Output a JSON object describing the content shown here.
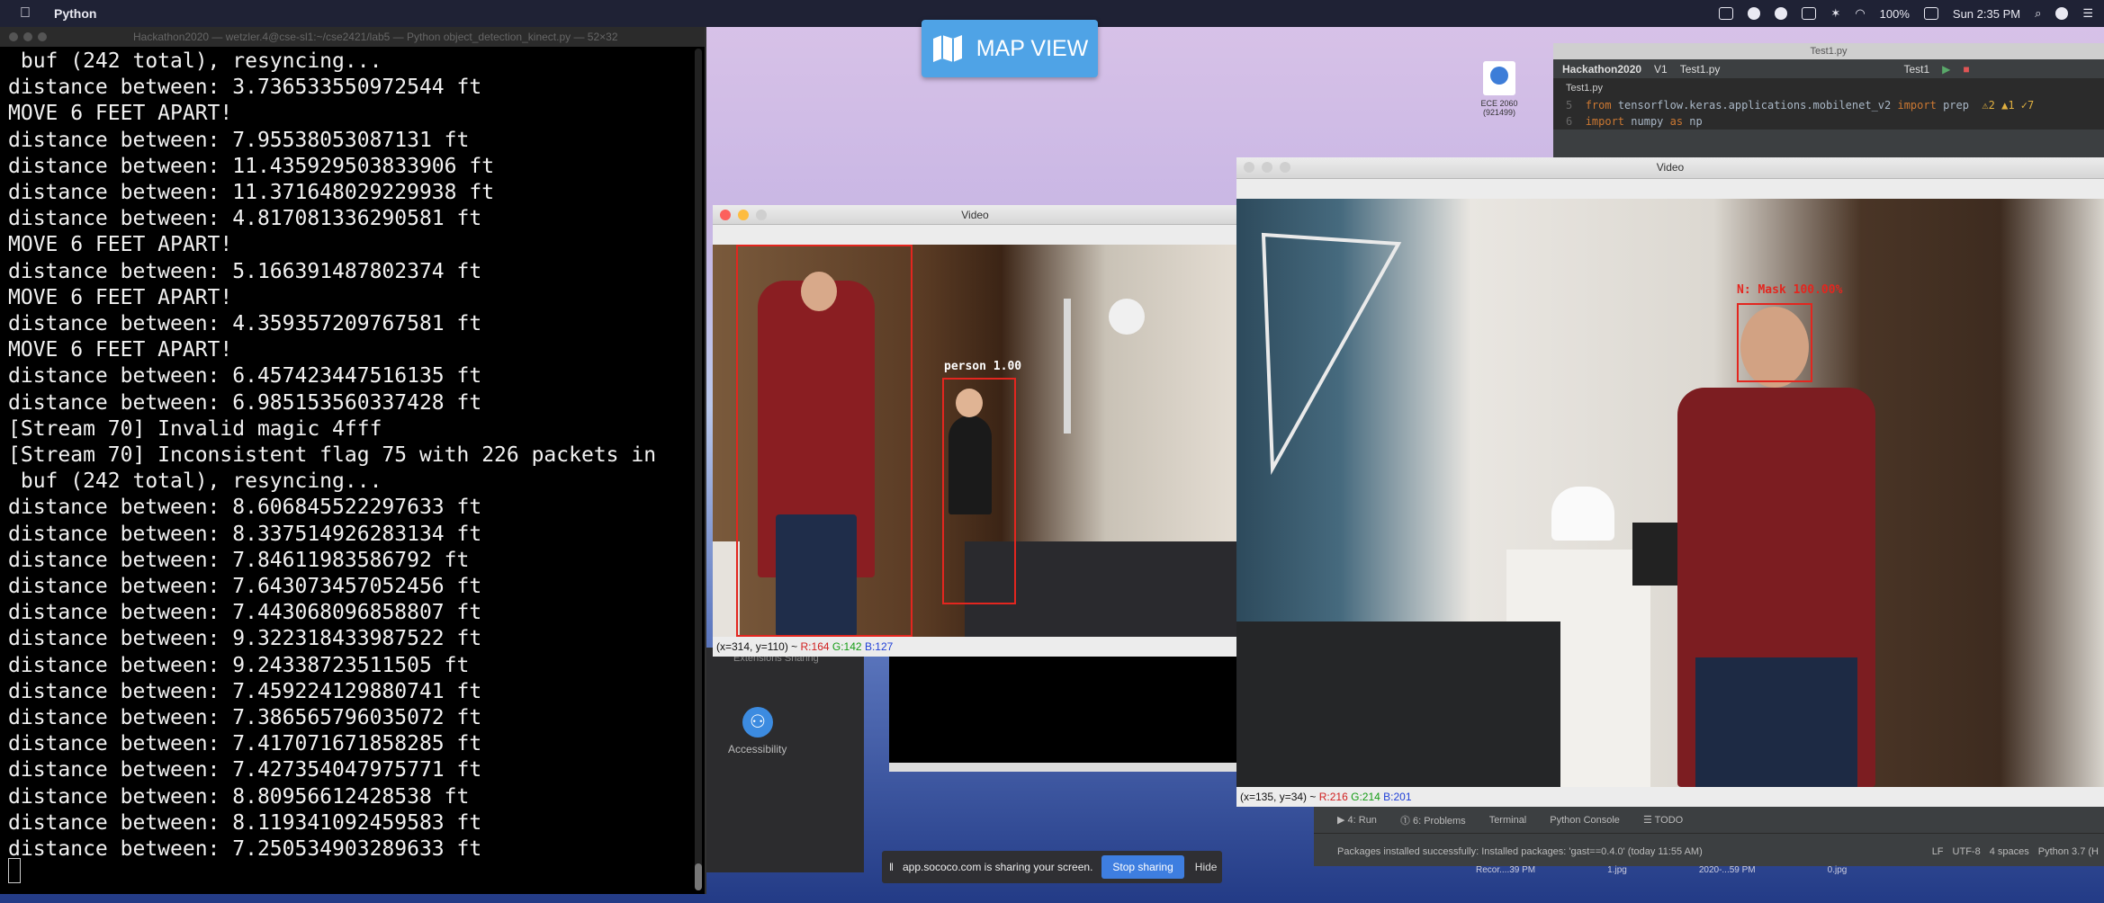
{
  "menubar": {
    "app_name": "Python",
    "battery": "100%",
    "clock": "Sun 2:35 PM"
  },
  "terminal": {
    "title": "Hackathon2020 — wetzler.4@cse-sl1:~/cse2421/lab5 — Python object_detection_kinect.py — 52×32",
    "lines": [
      " buf (242 total), resyncing...",
      "distance between: 3.736533550972544 ft",
      "MOVE 6 FEET APART!",
      "distance between: 7.95538053087131 ft",
      "distance between: 11.435929503833906 ft",
      "distance between: 11.371648029229938 ft",
      "distance between: 4.817081336290581 ft",
      "MOVE 6 FEET APART!",
      "distance between: 5.166391487802374 ft",
      "MOVE 6 FEET APART!",
      "distance between: 4.359357209767581 ft",
      "MOVE 6 FEET APART!",
      "distance between: 6.457423447516135 ft",
      "distance between: 6.985153560337428 ft",
      "[Stream 70] Invalid magic 4fff",
      "[Stream 70] Inconsistent flag 75 with 226 packets in",
      " buf (242 total), resyncing...",
      "distance between: 8.606845522297633 ft",
      "distance between: 8.337514926283134 ft",
      "distance between: 7.84611983586792 ft",
      "distance between: 7.643073457052456 ft",
      "distance between: 7.443068096858807 ft",
      "distance between: 9.322318433987522 ft",
      "distance between: 9.24338723511505 ft",
      "distance between: 7.459224129880741 ft",
      "distance between: 7.386565796035072 ft",
      "distance between: 7.417071671858285 ft",
      "distance between: 7.427354047975771 ft",
      "distance between: 8.80956612428538 ft",
      "distance between: 8.119341092459583 ft",
      "distance between: 7.250534903289633 ft"
    ]
  },
  "map_view": {
    "label": "MAP VIEW"
  },
  "desktop_icon": {
    "label": "ECE 2060 (921499)"
  },
  "syspref": {
    "row_labels": "Extensions   Sharing",
    "accessibility_label": "Accessibility"
  },
  "video_small": {
    "title": "Video",
    "detection_label": "person 1.00",
    "status": {
      "coords": "(x=314, y=110) ~ ",
      "r": "R:164",
      "g": "G:142",
      "b": "B:127"
    }
  },
  "video_large": {
    "title": "Video",
    "detection_label": "N: Mask 100.00%",
    "status": {
      "coords": "(x=135, y=34) ~ ",
      "r": "R:216",
      "g": "G:214",
      "b": "B:201"
    }
  },
  "ide": {
    "window_title": "Test1.py",
    "project": "Hackathon2020",
    "breadcrumb": "V1",
    "file": "Test1.py",
    "run_config": "Test1",
    "tab": "Test1.py",
    "code_lines": [
      {
        "num": "5",
        "kw1": "from",
        "text": " tensorflow.keras.applications.mobilenet_v2 ",
        "kw2": "import",
        "rest": " prep"
      },
      {
        "num": "6",
        "kw1": "import",
        "text": " numpy ",
        "kw2": "as",
        "rest": " np"
      }
    ],
    "inspections": "⚠2 ▲1 ✓7",
    "bottom_tabs": [
      "▶ 4: Run",
      "⓵ 6: Problems",
      "Terminal",
      "Python Console",
      "☰ TODO"
    ],
    "bottom_message": "Packages installed successfully: Installed packages: 'gast==0.4.0' (today 11:55 AM)",
    "bottom_right": [
      "LF",
      "UTF-8",
      "4 spaces",
      "Python 3.7 (H"
    ]
  },
  "share_bar": {
    "message": "app.sococo.com is sharing your screen.",
    "stop_label": "Stop sharing",
    "hide_label": "Hide"
  },
  "dock_labels": [
    "Recor....39 PM",
    "1.jpg",
    "2020-...59 PM",
    "0.jpg"
  ]
}
